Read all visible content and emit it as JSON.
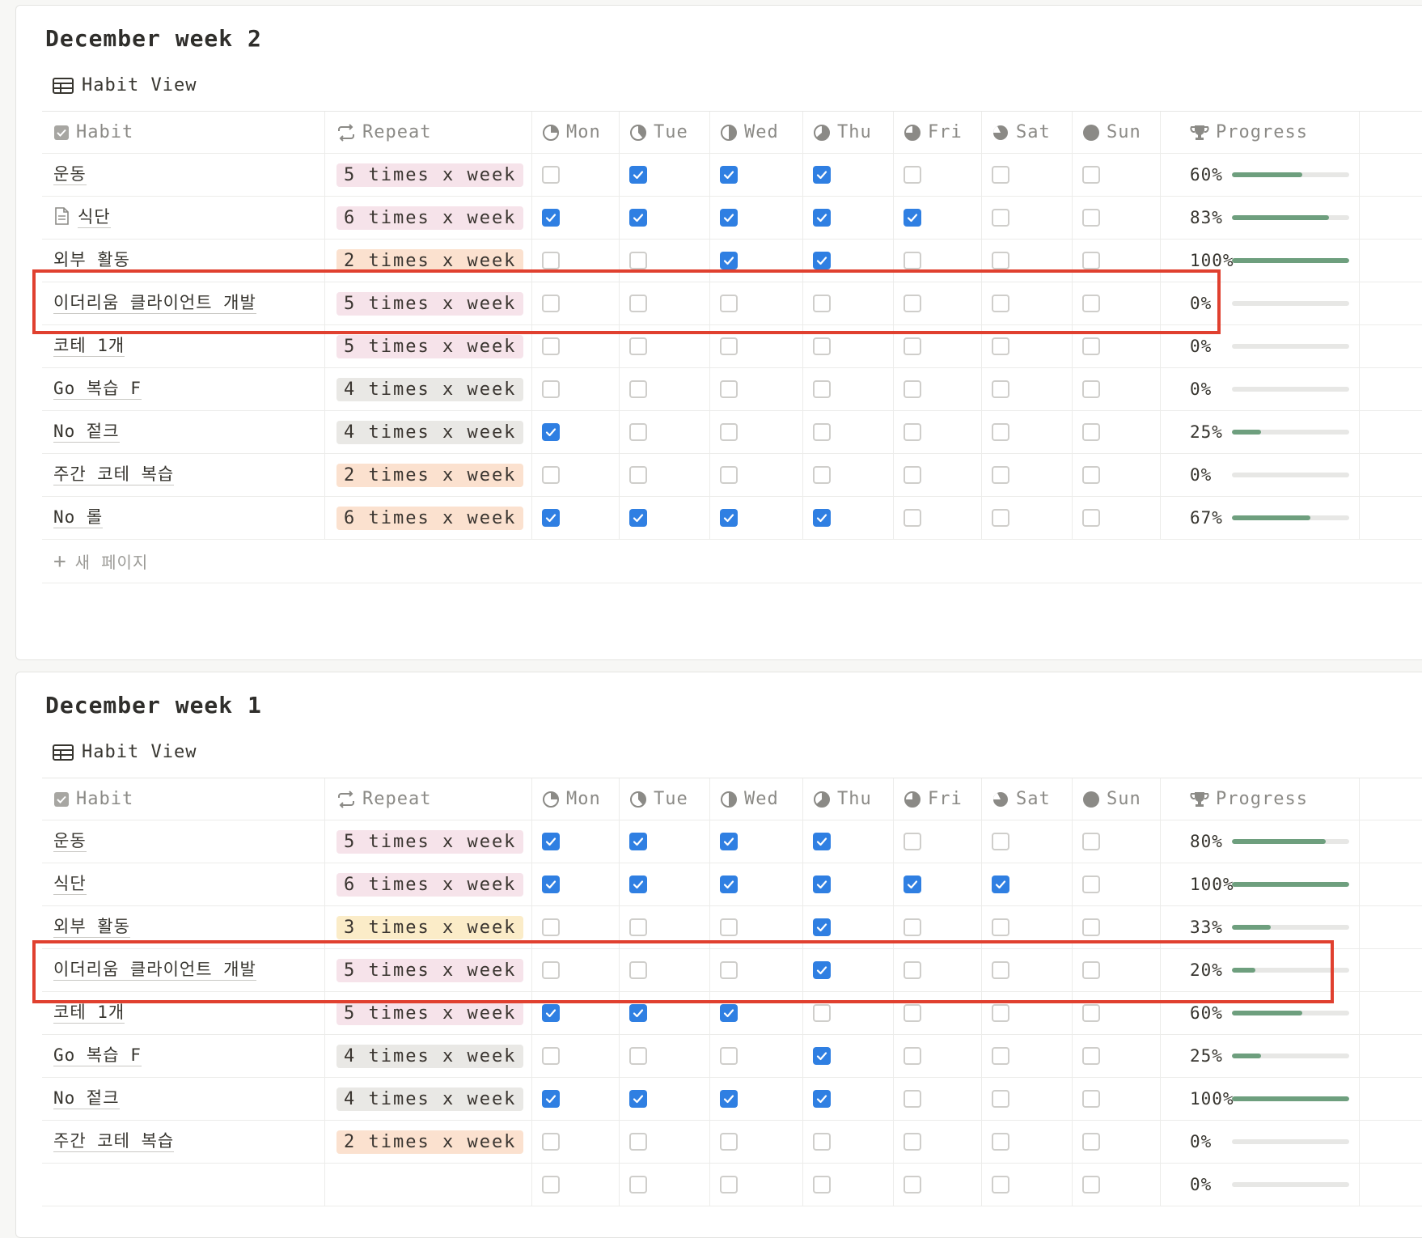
{
  "columns": {
    "habit": "Habit",
    "repeat": "Repeat",
    "days": [
      "Mon",
      "Tue",
      "Wed",
      "Thu",
      "Fri",
      "Sat",
      "Sun"
    ],
    "progress": "Progress"
  },
  "view_label": "Habit View",
  "new_page_label": "새 페이지",
  "colors": {
    "checked": "#2f7fe2",
    "progress_fill": "#6e9f7e",
    "highlight": "#e0402f"
  },
  "weeks": [
    {
      "title": "December week 2",
      "rows": [
        {
          "name": "운동",
          "doc_icon": false,
          "repeat": "5 times x week",
          "tag": "pink",
          "days": [
            0,
            1,
            1,
            1,
            0,
            0,
            0
          ],
          "pct": "60%",
          "fill": 0.6
        },
        {
          "name": "식단",
          "doc_icon": true,
          "repeat": "6 times x week",
          "tag": "pink",
          "days": [
            1,
            1,
            1,
            1,
            1,
            0,
            0
          ],
          "pct": "83%",
          "fill": 0.83
        },
        {
          "name": "외부 활동",
          "doc_icon": false,
          "repeat": "2 times x week",
          "tag": "orange",
          "days": [
            0,
            0,
            1,
            1,
            0,
            0,
            0
          ],
          "pct": "100%",
          "fill": 1.0
        },
        {
          "name": "이더리움 클라이언트 개발",
          "doc_icon": false,
          "repeat": "5 times x week",
          "tag": "pink",
          "days": [
            0,
            0,
            0,
            0,
            0,
            0,
            0
          ],
          "pct": "0%",
          "fill": 0
        },
        {
          "name": "코테 1개",
          "doc_icon": false,
          "repeat": "5 times x week",
          "tag": "pink",
          "days": [
            0,
            0,
            0,
            0,
            0,
            0,
            0
          ],
          "pct": "0%",
          "fill": 0
        },
        {
          "name": "Go 복습 F",
          "doc_icon": false,
          "repeat": "4 times x week",
          "tag": "gray",
          "days": [
            0,
            0,
            0,
            0,
            0,
            0,
            0
          ],
          "pct": "0%",
          "fill": 0
        },
        {
          "name": "No 젙크",
          "doc_icon": false,
          "repeat": "4 times x week",
          "tag": "gray",
          "days": [
            1,
            0,
            0,
            0,
            0,
            0,
            0
          ],
          "pct": "25%",
          "fill": 0.25
        },
        {
          "name": "주간 코테 복습",
          "doc_icon": false,
          "repeat": "2 times x week",
          "tag": "orange",
          "days": [
            0,
            0,
            0,
            0,
            0,
            0,
            0
          ],
          "pct": "0%",
          "fill": 0
        },
        {
          "name": "No 롤",
          "doc_icon": false,
          "repeat": "6 times x week",
          "tag": "orange",
          "days": [
            1,
            1,
            1,
            1,
            0,
            0,
            0
          ],
          "pct": "67%",
          "fill": 0.67
        }
      ]
    },
    {
      "title": "December week 1",
      "rows": [
        {
          "name": "운동",
          "doc_icon": false,
          "repeat": "5 times x week",
          "tag": "pink",
          "days": [
            1,
            1,
            1,
            1,
            0,
            0,
            0
          ],
          "pct": "80%",
          "fill": 0.8
        },
        {
          "name": "식단",
          "doc_icon": false,
          "repeat": "6 times x week",
          "tag": "pink",
          "days": [
            1,
            1,
            1,
            1,
            1,
            1,
            0
          ],
          "pct": "100%",
          "fill": 1.0
        },
        {
          "name": "외부 활동",
          "doc_icon": false,
          "repeat": "3 times x week",
          "tag": "yellow",
          "days": [
            0,
            0,
            0,
            1,
            0,
            0,
            0
          ],
          "pct": "33%",
          "fill": 0.33
        },
        {
          "name": "이더리움 클라이언트 개발",
          "doc_icon": false,
          "repeat": "5 times x week",
          "tag": "pink",
          "days": [
            0,
            0,
            0,
            1,
            0,
            0,
            0
          ],
          "pct": "20%",
          "fill": 0.2
        },
        {
          "name": "코테 1개",
          "doc_icon": false,
          "repeat": "5 times x week",
          "tag": "pink",
          "days": [
            1,
            1,
            1,
            0,
            0,
            0,
            0
          ],
          "pct": "60%",
          "fill": 0.6
        },
        {
          "name": "Go 복습 F",
          "doc_icon": false,
          "repeat": "4 times x week",
          "tag": "gray",
          "days": [
            0,
            0,
            0,
            1,
            0,
            0,
            0
          ],
          "pct": "25%",
          "fill": 0.25
        },
        {
          "name": "No 젙크",
          "doc_icon": false,
          "repeat": "4 times x week",
          "tag": "gray",
          "days": [
            1,
            1,
            1,
            1,
            0,
            0,
            0
          ],
          "pct": "100%",
          "fill": 1.0
        },
        {
          "name": "주간 코테 복습",
          "doc_icon": false,
          "repeat": "2 times x week",
          "tag": "orange",
          "days": [
            0,
            0,
            0,
            0,
            0,
            0,
            0
          ],
          "pct": "0%",
          "fill": 0
        },
        {
          "name": "",
          "doc_icon": false,
          "repeat": "",
          "tag": "",
          "days": [
            0,
            0,
            0,
            0,
            0,
            0,
            0
          ],
          "pct": "0%",
          "fill": 0
        }
      ]
    }
  ]
}
